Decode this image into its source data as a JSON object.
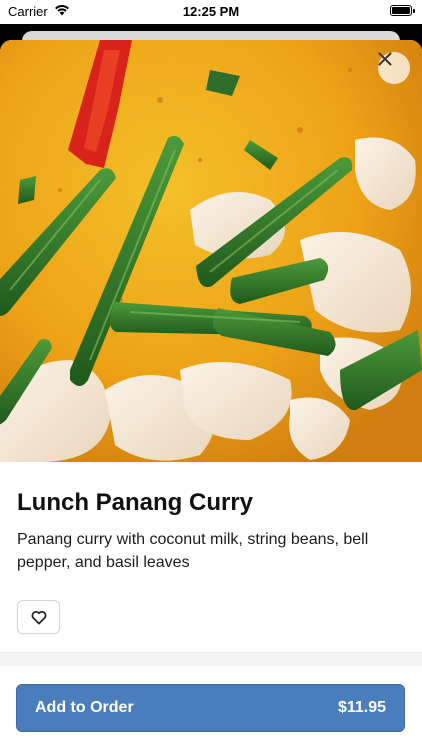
{
  "status_bar": {
    "carrier": "Carrier",
    "time": "12:25 PM"
  },
  "hero": {
    "image_subject": "panang curry with green beans, chicken and red pepper",
    "close_icon": "close-icon"
  },
  "item": {
    "title": "Lunch Panang Curry",
    "description": "Panang curry with coconut milk, string beans, bell pepper, and basil leaves",
    "favorite_icon": "heart-outline-icon"
  },
  "order": {
    "button_label": "Add to Order",
    "price": "$11.95"
  },
  "colors": {
    "primary_button": "#4a7dbb",
    "curry_sauce": "#eba014",
    "green_bean": "#2f6e2a",
    "red_pepper": "#d8231a"
  }
}
